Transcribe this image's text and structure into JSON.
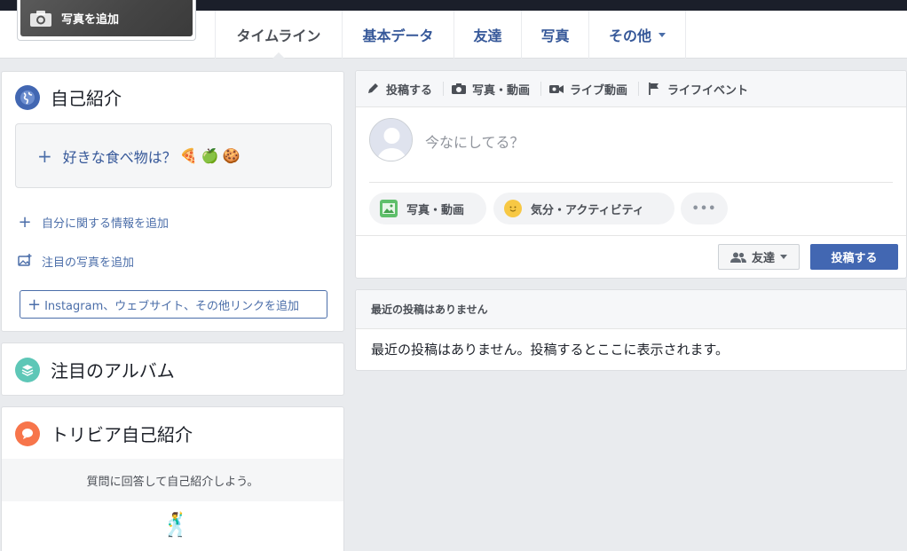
{
  "cover": {
    "add_photo_label": "写真を追加",
    "icon": "camera-icon"
  },
  "tabs": [
    {
      "label": "タイムライン",
      "active": true
    },
    {
      "label": "基本データ"
    },
    {
      "label": "友達"
    },
    {
      "label": "写真"
    },
    {
      "label": "その他"
    }
  ],
  "intro": {
    "title": "自己紹介",
    "icon": "globe-icon",
    "favorite_food": "好きな食べ物は？",
    "favorite_food_emojis": [
      "🍕",
      "🍏",
      "🍪"
    ],
    "add_info": "自分に関する情報を追加",
    "add_featured_photo": "注目の写真を追加",
    "add_links": "Instagram、ウェブサイト、その他リンクを追加"
  },
  "album": {
    "title": "注目のアルバム",
    "icon": "layers-icon"
  },
  "trivia": {
    "title": "トリビア自己紹介",
    "icon": "chat-bubble-icon",
    "prompt": "質問に回答して自己紹介しよう。",
    "illustration": "🕺"
  },
  "composer": {
    "tabs": [
      {
        "label": "投稿する",
        "icon": "pencil-icon"
      },
      {
        "label": "写真・動画",
        "icon": "camera-icon"
      },
      {
        "label": "ライブ動画",
        "icon": "video-camera-icon"
      },
      {
        "label": "ライフイベント",
        "icon": "flag-icon"
      }
    ],
    "placeholder": "今なにしてる？",
    "photo_video": "写真・動画",
    "feeling_activity": "気分・アクティビティ",
    "more": "•••",
    "audience": "友達",
    "post": "投稿する"
  },
  "recent": {
    "header": "最近の投稿はありません",
    "body": "最近の投稿はありません。投稿するとここに表示されます。"
  },
  "colors": {
    "brand": "#4267b2",
    "link": "#4b6ea9",
    "background": "#e9ebee"
  }
}
